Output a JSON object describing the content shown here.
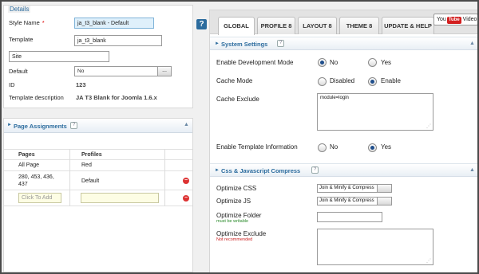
{
  "details": {
    "legend": "Details",
    "style_name_label": "Style Name",
    "required_mark": "*",
    "style_name_value": "ja_t3_blank - Default",
    "template_label": "Template",
    "template_value": "ja_t3_blank",
    "site_value": "Site",
    "default_label": "Default",
    "default_value": "No",
    "default_btn": "...",
    "id_label": "ID",
    "id_value": "123",
    "template_desc_label": "Template description",
    "template_desc_value": "JA T3 Blank for Joomla 1.6.x"
  },
  "page_assignments": {
    "title": "Page Assignments",
    "help": "?",
    "columns": {
      "pages": "Pages",
      "profiles": "Profiles"
    },
    "rows": [
      {
        "pages": "All Page",
        "profile": "Red"
      },
      {
        "pages_line1": "280, 453, 436,",
        "pages_line2": "437",
        "profile": "Default",
        "delete": "−"
      }
    ],
    "add_placeholder": "Click To Add",
    "add_delete": "−"
  },
  "help_icon": "?",
  "tabs": [
    {
      "label": "GLOBAL",
      "active": true
    },
    {
      "label": "PROFILE 8"
    },
    {
      "label": "LAYOUT 8"
    },
    {
      "label": "THEME 8"
    },
    {
      "label": "UPDATE & HELP"
    }
  ],
  "youtube": {
    "logo_text": "You",
    "logo_tube": "Tube",
    "label": "Video"
  },
  "system_settings": {
    "title": "System Settings",
    "help": "?",
    "dev_mode_label": "Enable Development Mode",
    "dev_mode_no": "No",
    "dev_mode_yes": "Yes",
    "dev_mode_selected": "No",
    "cache_mode_label": "Cache Mode",
    "cache_disabled": "Disabled",
    "cache_enable": "Enable",
    "cache_selected": "Enable",
    "cache_exclude_label": "Cache Exclude",
    "cache_exclude_value": "module=login",
    "template_info_label": "Enable Template Information",
    "template_info_no": "No",
    "template_info_yes": "Yes",
    "template_info_selected": "Yes"
  },
  "css_js": {
    "title": "Css & Javascript Compress",
    "help": "?",
    "optimize_css_label": "Optimize CSS",
    "optimize_css_value": "Join & Minify & Compress",
    "optimize_js_label": "Optimize JS",
    "optimize_js_value": "Join & Minify & Compress",
    "optimize_folder_label": "Optimize Folder",
    "optimize_folder_note": "must be writable",
    "optimize_exclude_label": "Optimize Exclude",
    "optimize_exclude_note": "Not recommended"
  },
  "colors": {
    "accent": "#2c6c9e",
    "ok_note": "#2a8a2a",
    "warn_note": "#cc2222",
    "delete": "#dd3333"
  }
}
